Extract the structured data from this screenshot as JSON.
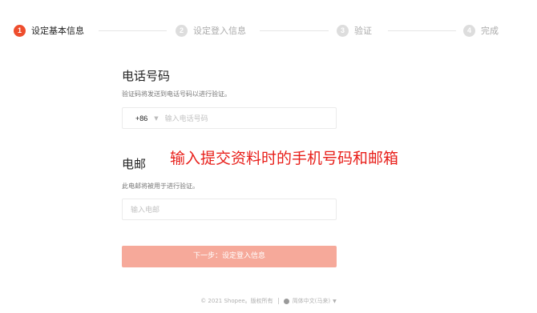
{
  "stepper": {
    "steps": [
      {
        "number": "1",
        "label": "设定基本信息",
        "state": "active"
      },
      {
        "number": "2",
        "label": "设定登入信息",
        "state": "inactive"
      },
      {
        "number": "3",
        "label": "验证",
        "state": "inactive"
      },
      {
        "number": "4",
        "label": "完成",
        "state": "inactive"
      }
    ]
  },
  "phone": {
    "title": "电话号码",
    "description": "验证码将发送到电话号码以进行验证。",
    "country_code": "+86",
    "caret": "▼",
    "placeholder": "输入电话号码"
  },
  "email": {
    "title": "电邮",
    "description": "此电邮将被用于进行验证。",
    "placeholder": "输入电邮"
  },
  "annotation": "输入提交资料时的手机号码和邮箱",
  "next_button": "下一步：设定登入信息",
  "footer": {
    "copyright": "© 2021 Shopee。版权所有",
    "language": "简体中文(马来)",
    "caret": "▼"
  },
  "colors": {
    "accent": "#ee4d2d",
    "button_disabled": "#f6a99a",
    "annotation_red": "#e8201b"
  }
}
